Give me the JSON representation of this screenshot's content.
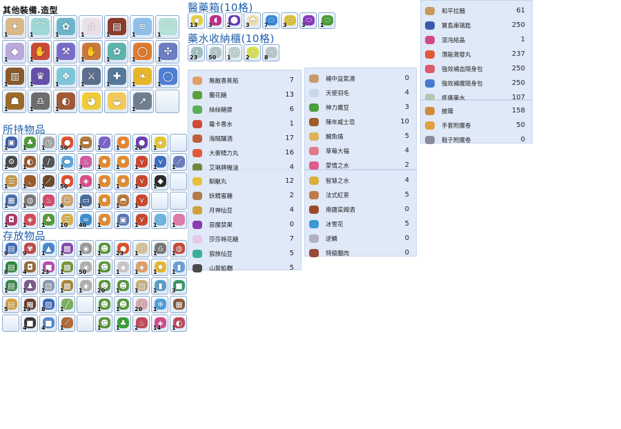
{
  "sections": {
    "equip": {
      "title": "其他裝備.造型"
    },
    "carry": {
      "title": "所持物品"
    },
    "storage": {
      "title": "存放物品"
    },
    "medbox": {
      "title": "醫藥箱(10格)"
    },
    "potion": {
      "title": "藥水收納櫃(10格)"
    }
  },
  "equip_grid": [
    {
      "icon": "gear-icon",
      "qty": "1",
      "color": "#d9b98a"
    },
    {
      "icon": "boots-icon",
      "qty": "1",
      "color": "#9fd7d4"
    },
    {
      "icon": "fairy-icon",
      "qty": "1",
      "color": "#6db6c9"
    },
    {
      "icon": "arch-icon",
      "qty": "1",
      "color": "#e9dfe6"
    },
    {
      "icon": "armor-icon",
      "qty": "1",
      "color": "#8b3b2e"
    },
    {
      "icon": "wings-icon",
      "qty": "1",
      "color": "#8fc0ea"
    },
    {
      "icon": "boots-icon",
      "qty": "1",
      "color": "#b5e0d8"
    },
    {
      "icon": "crystal-icon",
      "qty": "1",
      "color": "#b9a9dd"
    },
    {
      "icon": "glove-icon",
      "qty": "1",
      "color": "#c84a3a"
    },
    {
      "icon": "axe-icon",
      "qty": "1",
      "color": "#7a6dc9"
    },
    {
      "icon": "glove-icon",
      "qty": "1",
      "color": "#c9793f"
    },
    {
      "icon": "fairy-icon",
      "qty": "1",
      "color": "#5fb3ae"
    },
    {
      "icon": "ring-icon",
      "qty": "1",
      "color": "#e07a2e"
    },
    {
      "icon": "mace-icon",
      "qty": "1",
      "color": "#6b7ec2"
    },
    {
      "icon": "cloak-icon",
      "qty": "1",
      "color": "#8a5a2c"
    },
    {
      "icon": "robe-icon",
      "qty": "1",
      "color": "#6650a9"
    },
    {
      "icon": "crest-icon",
      "qty": "1",
      "color": "#7fc6d9"
    },
    {
      "icon": "sword-icon",
      "qty": "1",
      "color": "#5b6e8e"
    },
    {
      "icon": "halberd-icon",
      "qty": "1",
      "color": "#55789b"
    },
    {
      "icon": "wing-icon",
      "qty": "1",
      "color": "#e5b52a"
    },
    {
      "icon": "ring-icon",
      "qty": "1",
      "color": "#4f7fd6"
    },
    {
      "icon": "helmet-icon",
      "qty": "1",
      "color": "#9b6b2a"
    },
    {
      "icon": "bell-icon",
      "qty": "1",
      "color": "#6d6d6d"
    },
    {
      "icon": "bag-icon",
      "qty": "1",
      "color": "#a05a34"
    },
    {
      "icon": "duck-icon",
      "qty": "",
      "color": "#f1cc3a"
    },
    {
      "icon": "shell-icon",
      "qty": "",
      "color": "#f4c957"
    },
    {
      "icon": "spear-icon",
      "qty": "1",
      "color": "#6f7f8f"
    },
    {
      "icon": "",
      "qty": "",
      "color": ""
    }
  ],
  "carry_grid": [
    {
      "icon": "box-icon",
      "qty": "1",
      "color": "#3c5fa6"
    },
    {
      "icon": "plant-icon",
      "qty": "1",
      "color": "#4e9a38"
    },
    {
      "icon": "clock-icon",
      "qty": "1",
      "color": "#a3a3a3"
    },
    {
      "icon": "apple-icon",
      "qty": "50",
      "color": "#e0522a"
    },
    {
      "icon": "log-icon",
      "qty": "1",
      "color": "#b27a3a"
    },
    {
      "icon": "wand-icon",
      "qty": "1",
      "color": "#7a62c7"
    },
    {
      "icon": "star-icon",
      "qty": "1",
      "color": "#e8862e"
    },
    {
      "icon": "ball-icon",
      "qty": "20",
      "color": "#6b3fb0"
    },
    {
      "icon": "gem-icon",
      "qty": "1",
      "color": "#e7c430"
    },
    {
      "icon": "",
      "qty": "",
      "color": ""
    },
    {
      "icon": "tool-icon",
      "qty": "1",
      "color": "#4a4a4a"
    },
    {
      "icon": "bag-icon",
      "qty": "1",
      "color": "#9a5b2f"
    },
    {
      "icon": "knife-icon",
      "qty": "1",
      "color": "#555"
    },
    {
      "icon": "egg-icon",
      "qty": "1",
      "color": "#5aa7d8"
    },
    {
      "icon": "potion-icon",
      "qty": "3",
      "color": "#d35aa3"
    },
    {
      "icon": "star-icon",
      "qty": "1",
      "color": "#e58c2e"
    },
    {
      "icon": "star-icon",
      "qty": "1",
      "color": "#e58c2e"
    },
    {
      "icon": "pliers-icon",
      "qty": "1",
      "color": "#d0472f"
    },
    {
      "icon": "pliers-icon",
      "qty": "1",
      "color": "#3e6fc2"
    },
    {
      "icon": "staff-icon",
      "qty": "1",
      "color": "#6a7bb8"
    },
    {
      "icon": "scroll-icon",
      "qty": "1",
      "color": "#c79a4a"
    },
    {
      "icon": "bow-icon",
      "qty": "1",
      "color": "#9b5a2a"
    },
    {
      "icon": "rod-icon",
      "qty": "1",
      "color": "#6b4a2a"
    },
    {
      "icon": "apple-icon",
      "qty": "50",
      "color": "#e0522a"
    },
    {
      "icon": "gem-icon",
      "qty": "1",
      "color": "#d94f8b"
    },
    {
      "icon": "star-icon",
      "qty": "1",
      "color": "#e58c2e"
    },
    {
      "icon": "star-icon",
      "qty": "1",
      "color": "#e58c2e"
    },
    {
      "icon": "pliers-icon",
      "qty": "1",
      "color": "#c9482d"
    },
    {
      "icon": "crystal-icon",
      "qty": "1",
      "color": "#2a2a2a"
    },
    {
      "icon": "",
      "qty": "",
      "color": ""
    },
    {
      "icon": "machine-icon",
      "qty": "1",
      "color": "#4b6fb0"
    },
    {
      "icon": "jug-icon",
      "qty": "1",
      "color": "#7a7a7a"
    },
    {
      "icon": "potion-icon",
      "qty": "1",
      "color": "#d34a6a"
    },
    {
      "icon": "doll-icon",
      "qty": "6",
      "color": "#d4a56a"
    },
    {
      "icon": "card-icon",
      "qty": "1",
      "color": "#4b6f9c"
    },
    {
      "icon": "star-icon",
      "qty": "1",
      "color": "#e58c2e"
    },
    {
      "icon": "bread-icon",
      "qty": "1",
      "color": "#b9773a"
    },
    {
      "icon": "pliers-icon",
      "qty": "1",
      "color": "#c9482d"
    },
    {
      "icon": "",
      "qty": "",
      "color": ""
    },
    {
      "icon": "",
      "qty": "",
      "color": ""
    },
    {
      "icon": "basket-icon",
      "qty": "1",
      "color": "#b03a6a"
    },
    {
      "icon": "gem-icon",
      "qty": "1",
      "color": "#d04a5a"
    },
    {
      "icon": "plant-icon",
      "qty": "1",
      "color": "#5a9a3a"
    },
    {
      "icon": "scroll-icon",
      "qty": "10",
      "color": "#d8b04a"
    },
    {
      "icon": "fish-icon",
      "qty": "40",
      "color": "#3f8fd0"
    },
    {
      "icon": "star-icon",
      "qty": "1",
      "color": "#e58c2e"
    },
    {
      "icon": "box-icon",
      "qty": "1",
      "color": "#5a7ab8"
    },
    {
      "icon": "pliers-icon",
      "qty": "1",
      "color": "#c9482d"
    },
    {
      "icon": "bottle-icon",
      "qty": "1",
      "color": "#6ab3e0"
    },
    {
      "icon": "bottle-icon",
      "qty": "1",
      "color": "#e07aa8"
    }
  ],
  "storage_grid": [
    {
      "icon": "book-icon",
      "qty": "9",
      "color": "#3f6fc2"
    },
    {
      "icon": "flower-icon",
      "qty": "9",
      "color": "#c04a4a"
    },
    {
      "icon": "hat-icon",
      "qty": "1",
      "color": "#4a8ad0"
    },
    {
      "icon": "chest-icon",
      "qty": "1",
      "color": "#8a4ab0"
    },
    {
      "icon": "sphere-icon",
      "qty": "1",
      "color": "#9a9a9a"
    },
    {
      "icon": "elf-icon",
      "qty": "1",
      "color": "#5a9a3a"
    },
    {
      "icon": "apple-icon",
      "qty": "23",
      "color": "#e0522a"
    },
    {
      "icon": "bone-icon",
      "qty": "1",
      "color": "#d4c29a"
    },
    {
      "icon": "bell-icon",
      "qty": "1",
      "color": "#777"
    },
    {
      "icon": "pot-icon",
      "qty": "1",
      "color": "#c94a3a"
    },
    {
      "icon": "book-icon",
      "qty": "8",
      "color": "#2f8a3a"
    },
    {
      "icon": "basket-icon",
      "qty": "4",
      "color": "#9a6a3a"
    },
    {
      "icon": "cube-icon",
      "qty": "23",
      "color": "#c04ab0"
    },
    {
      "icon": "chest-icon",
      "qty": "1",
      "color": "#7a9a3a"
    },
    {
      "icon": "sphere-icon",
      "qty": "50",
      "color": "#b0b0b0"
    },
    {
      "icon": "elf-icon",
      "qty": "1",
      "color": "#5a9a3a"
    },
    {
      "icon": "sphere-icon",
      "qty": "1",
      "color": "#c9c9c9"
    },
    {
      "icon": "gem-icon",
      "qty": "1",
      "color": "#e0a06a"
    },
    {
      "icon": "star-icon",
      "qty": "1",
      "color": "#e8b82e"
    },
    {
      "icon": "cylinder-icon",
      "qty": "1",
      "color": "#6aa0d8"
    },
    {
      "icon": "book-icon",
      "qty": "1",
      "color": "#3a8a4a"
    },
    {
      "icon": "figure-icon",
      "qty": "1",
      "color": "#7a5a8a"
    },
    {
      "icon": "block-icon",
      "qty": "1",
      "color": "#8a9ab0"
    },
    {
      "icon": "chest-icon",
      "qty": "1",
      "color": "#a88a3a"
    },
    {
      "icon": "sphere-icon",
      "qty": "1",
      "color": "#b0b0b0"
    },
    {
      "icon": "elf-icon",
      "qty": "20",
      "color": "#5a9a3a"
    },
    {
      "icon": "elf-icon",
      "qty": "1",
      "color": "#5a9a3a"
    },
    {
      "icon": "block-icon",
      "qty": "1",
      "color": "#c8b07a"
    },
    {
      "icon": "cylinder-icon",
      "qty": "1",
      "color": "#5aa0c8"
    },
    {
      "icon": "cube-icon",
      "qty": "3",
      "color": "#3a9a6a"
    },
    {
      "icon": "book-icon",
      "qty": "5",
      "color": "#d8a03a"
    },
    {
      "icon": "choco-icon",
      "qty": "13",
      "color": "#6a3a2a"
    },
    {
      "icon": "block-icon",
      "qty": "8",
      "color": "#3a6ac0"
    },
    {
      "icon": "stick-icon",
      "qty": "1",
      "color": "#7ab05a"
    },
    {
      "icon": "",
      "qty": "",
      "color": ""
    },
    {
      "icon": "elf-icon",
      "qty": "1",
      "color": "#5a9a3a"
    },
    {
      "icon": "elf-icon",
      "qty": "1",
      "color": "#5a9a3a"
    },
    {
      "icon": "bone-icon",
      "qty": "20",
      "color": "#d4a8b0"
    },
    {
      "icon": "snow-icon",
      "qty": "1",
      "color": "#4aa0e0"
    },
    {
      "icon": "choco-icon",
      "qty": "",
      "color": "#8a5a3a"
    },
    {
      "icon": "",
      "qty": "",
      "color": ""
    },
    {
      "icon": "cube-icon",
      "qty": "4",
      "color": "#3a3a3a"
    },
    {
      "icon": "cube-icon",
      "qty": "4",
      "color": "#5a8ad0"
    },
    {
      "icon": "brush-icon",
      "qty": "1",
      "color": "#b06a3a"
    },
    {
      "icon": "",
      "qty": "",
      "color": ""
    },
    {
      "icon": "elf-icon",
      "qty": "1",
      "color": "#5a9a3a"
    },
    {
      "icon": "clover-icon",
      "qty": "1",
      "color": "#3aa03a"
    },
    {
      "icon": "potion-icon",
      "qty": "2",
      "color": "#c04a5a"
    },
    {
      "icon": "gem-icon",
      "qty": "14",
      "color": "#d04a8a"
    },
    {
      "icon": "bag-icon",
      "qty": "1",
      "color": "#c04a5a"
    }
  ],
  "medbox_grid": [
    {
      "icon": "box-icon",
      "qty": "13",
      "color": "#e8d43a"
    },
    {
      "icon": "pill-icon",
      "qty": "3",
      "color": "#c0308a"
    },
    {
      "icon": "disc-icon",
      "qty": "2",
      "color": "#6a3ac0"
    },
    {
      "icon": "bread-icon",
      "qty": "3",
      "color": "#f0e0b0"
    },
    {
      "icon": "capsule-icon",
      "qty": "7",
      "color": "#3a8ad8"
    },
    {
      "icon": "capsule-icon",
      "qty": "3",
      "color": "#d8c03a"
    },
    {
      "icon": "capsule-icon",
      "qty": "3",
      "color": "#8a3ac0"
    },
    {
      "icon": "capsule-icon",
      "qty": "1",
      "color": "#4aa03a"
    }
  ],
  "potion_grid": [
    {
      "icon": "flask-icon",
      "qty": "23",
      "color": "#a0c0c0"
    },
    {
      "icon": "flask-icon",
      "qty": "50",
      "color": "#b0c8c8"
    },
    {
      "icon": "flask-icon",
      "qty": "1",
      "color": "#c0d0d0"
    },
    {
      "icon": "flask-icon",
      "qty": "2",
      "color": "#d8e04a"
    },
    {
      "icon": "flask-icon",
      "qty": "8",
      "color": "#b8c8c8"
    }
  ],
  "list_a1": [
    {
      "name": "無敵香蕉船",
      "count": "7",
      "color": "#e0a06a"
    },
    {
      "name": "蘭花糖",
      "count": "13",
      "color": "#5aa03a"
    },
    {
      "name": "絲絲糖漿",
      "count": "6",
      "color": "#5ab05a"
    },
    {
      "name": "蘿卡香水",
      "count": "1",
      "color": "#d04a3a"
    },
    {
      "name": "海賊釀酒",
      "count": "17",
      "color": "#c0603a"
    },
    {
      "name": "大麥精力丸",
      "count": "16",
      "color": "#e05a3a"
    },
    {
      "name": "艾琳牌機油",
      "count": "4",
      "color": "#6a8a3a"
    }
  ],
  "list_a2": [
    {
      "name": "馴獸丸",
      "count": "12",
      "color": "#e8c03a"
    },
    {
      "name": "妖精蜜糖",
      "count": "2",
      "color": "#b07a4a"
    },
    {
      "name": "月神仙豆",
      "count": "4",
      "color": "#d0a03a"
    },
    {
      "name": "惡魔禁果",
      "count": "0",
      "color": "#8a3ab0"
    },
    {
      "name": "莎莎棉花糖",
      "count": "7",
      "color": "#e8c8e8"
    },
    {
      "name": "狼族仙豆",
      "count": "5",
      "color": "#3ab09a"
    },
    {
      "name": "山葵餡糰",
      "count": "5",
      "color": "#4a4a4a"
    }
  ],
  "list_b1": [
    {
      "name": "補中益氣湯",
      "count": "0",
      "color": "#c89a6a"
    },
    {
      "name": "天使羽毛",
      "count": "4",
      "color": "#c8d8e8"
    },
    {
      "name": "神力魔豆",
      "count": "3",
      "color": "#4aa03a"
    },
    {
      "name": "陳年威士忌",
      "count": "10",
      "color": "#a05a2a"
    },
    {
      "name": "鯛魚燒",
      "count": "5",
      "color": "#e0b05a"
    },
    {
      "name": "草莓大福",
      "count": "4",
      "color": "#e07a8a"
    },
    {
      "name": "愛情之水",
      "count": "2",
      "color": "#e05a8a"
    }
  ],
  "list_b2": [
    {
      "name": "智慧之水",
      "count": "4",
      "color": "#d8b03a"
    },
    {
      "name": "法式紅茶",
      "count": "5",
      "color": "#c07a4a"
    },
    {
      "name": "南疆菜姆酒",
      "count": "0",
      "color": "#9a4a2a"
    },
    {
      "name": "冰雪花",
      "count": "5",
      "color": "#3a9ad8"
    },
    {
      "name": "逆鱗",
      "count": "0",
      "color": "#b0b0c0"
    },
    {
      "name": "特級臘肉",
      "count": "0",
      "color": "#9a4a3a"
    }
  ],
  "list_c1": [
    {
      "name": "和平拉麵",
      "count": "61",
      "color": "#c89a5a"
    },
    {
      "name": "寶島庫璃匙",
      "count": "250",
      "color": "#3a5ab0"
    },
    {
      "name": "混沌結晶",
      "count": "1",
      "color": "#d04a8a"
    },
    {
      "name": "潛能激發丸",
      "count": "237",
      "color": "#e05a3a"
    },
    {
      "name": "強效補血隨身包",
      "count": "250",
      "color": "#e05a6a"
    },
    {
      "name": "強效補魔隨身包",
      "count": "250",
      "color": "#4a7ad0"
    },
    {
      "name": "疼痛藥水",
      "count": "107",
      "color": "#b0c8b0"
    }
  ],
  "list_c2": [
    {
      "name": "披薩",
      "count": "158",
      "color": "#d08a3a"
    },
    {
      "name": "手套附魔卷",
      "count": "50",
      "color": "#e0a03a"
    },
    {
      "name": "鞋子附魔卷",
      "count": "0",
      "color": "#8a8a9a"
    }
  ]
}
